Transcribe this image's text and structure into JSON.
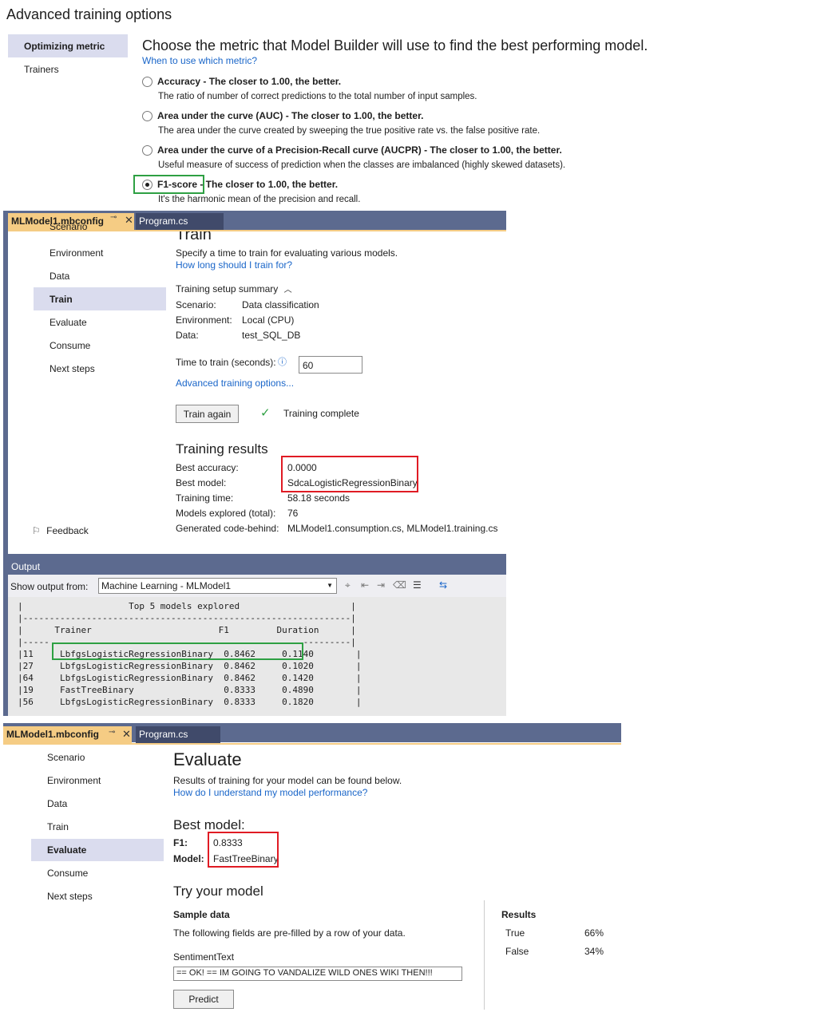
{
  "advanced": {
    "title": "Advanced training options",
    "nav": {
      "selected": "Optimizing metric",
      "other": "Trainers"
    },
    "heading": "Choose the metric that Model Builder will use to find the best performing model.",
    "help_link": "When to use which metric?",
    "options": [
      {
        "label": "Accuracy - The closer to 1.00, the better.",
        "desc": "The ratio of number of correct predictions to the total number of input samples.",
        "selected": false
      },
      {
        "label": "Area under the curve (AUC) - The closer to 1.00, the better.",
        "desc": "The area under the curve created by sweeping the true positive rate vs. the false positive rate.",
        "selected": false
      },
      {
        "label": "Area under the curve of a Precision-Recall curve (AUCPR) - The closer to 1.00, the better.",
        "desc": "Useful measure of success of prediction when the classes are imbalanced (highly skewed datasets).",
        "selected": false
      },
      {
        "label": "F1-score - The closer to 1.00, the better.",
        "desc": "It's the harmonic mean of the precision and recall.",
        "selected": true
      }
    ]
  },
  "train": {
    "tabs": {
      "active": "MLModel1.mbconfig",
      "other": "Program.cs",
      "pin": "⊸",
      "close": "✕"
    },
    "nav": [
      "Scenario",
      "Environment",
      "Data",
      "Train",
      "Evaluate",
      "Consume",
      "Next steps"
    ],
    "nav_selected": "Train",
    "feedback": "Feedback",
    "title": "Train",
    "subtitle": "Specify a time to train for evaluating various models.",
    "help_link": "How long should I train for?",
    "summary_label": "Training setup summary",
    "summary": [
      {
        "k": "Scenario:",
        "v": "Data classification"
      },
      {
        "k": "Environment:",
        "v": "Local (CPU)"
      },
      {
        "k": "Data:",
        "v": "test_SQL_DB"
      }
    ],
    "time_label": "Time to train (seconds):",
    "time_value": "60",
    "advanced_link": "Advanced training options...",
    "train_again": "Train again",
    "status": "Training complete",
    "results_title": "Training results",
    "results": [
      {
        "k": "Best accuracy:",
        "v": "0.0000"
      },
      {
        "k": "Best model:",
        "v": "SdcaLogisticRegressionBinary"
      },
      {
        "k": "Training time:",
        "v": "58.18 seconds"
      },
      {
        "k": "Models explored (total):",
        "v": "76"
      },
      {
        "k": "Generated code-behind:",
        "v": "MLModel1.consumption.cs, MLModel1.training.cs"
      }
    ]
  },
  "output": {
    "title": "Output",
    "show_from": "Show output from:",
    "source": "Machine Learning - MLModel1",
    "lines": [
      "|                    Top 5 models explored                     |",
      "|--------------------------------------------------------------|",
      "|      Trainer                        F1         Duration      |",
      "|-----                                                ---------|",
      "|11     LbfgsLogisticRegressionBinary  0.8462     0.1140        |",
      "|27     LbfgsLogisticRegressionBinary  0.8462     0.1020        |",
      "|64     LbfgsLogisticRegressionBinary  0.8462     0.1420        |",
      "|19     FastTreeBinary                 0.8333     0.4890        |",
      "|56     LbfgsLogisticRegressionBinary  0.8333     0.1820        |"
    ]
  },
  "evaluate": {
    "tabs": {
      "active": "MLModel1.mbconfig",
      "other": "Program.cs",
      "pin": "⊸",
      "close": "✕"
    },
    "nav": [
      "Scenario",
      "Environment",
      "Data",
      "Train",
      "Evaluate",
      "Consume",
      "Next steps"
    ],
    "nav_selected": "Evaluate",
    "title": "Evaluate",
    "subtitle": "Results of training for your model can be found below.",
    "help_link": "How do I understand my model performance?",
    "best_model_title": "Best model:",
    "f1_label": "F1:",
    "f1_value": "0.8333",
    "model_label": "Model:",
    "model_value": "FastTreeBinary",
    "try_title": "Try your model",
    "sample_title": "Sample data",
    "sample_desc": "The following fields are pre-filled by a row of your data.",
    "field_label": "SentimentText",
    "field_value": "== OK! ==  IM GOING TO VANDALIZE WILD ONES WIKI THEN!!!",
    "predict": "Predict",
    "results_title": "Results",
    "results": [
      {
        "label": "True",
        "value": "66%"
      },
      {
        "label": "False",
        "value": "34%"
      }
    ]
  }
}
